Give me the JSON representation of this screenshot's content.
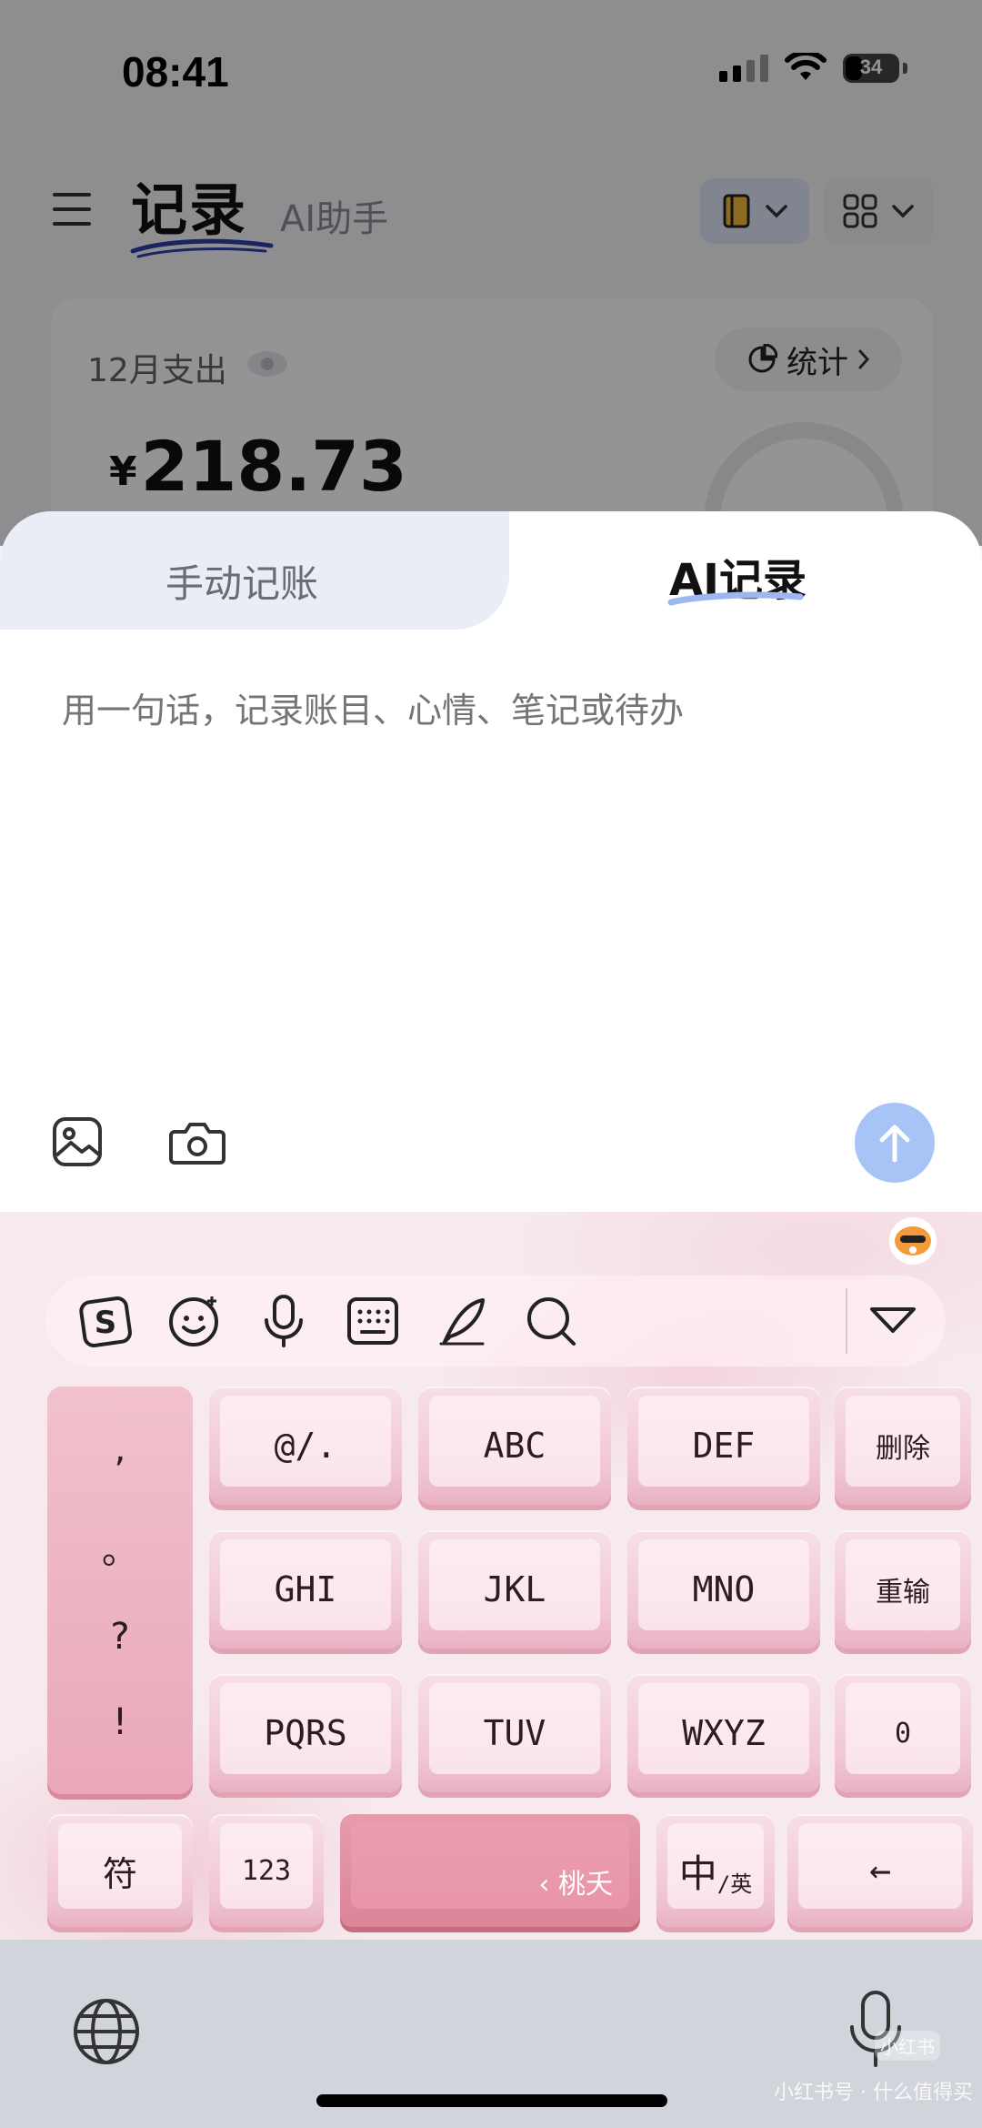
{
  "status": {
    "time": "08:41",
    "battery": "34"
  },
  "header": {
    "brand": "记录",
    "subtitle": "AI助手"
  },
  "summary": {
    "month_label": "12月支出",
    "stats_label": "统计",
    "currency": "¥",
    "amount": "218.73"
  },
  "sheet": {
    "tab_manual": "手动记账",
    "tab_ai": "AI记录",
    "input_placeholder": "用一句话，记录账目、心情、笔记或待办"
  },
  "keyboard": {
    "punctuation": [
      ",",
      "。",
      "?",
      "!"
    ],
    "row1": [
      "@/.",
      "ABC",
      "DEF",
      "删除"
    ],
    "row2": [
      "GHI",
      "JKL",
      "MNO",
      "重输"
    ],
    "row3": [
      "PQRS",
      "TUV",
      "WXYZ",
      "0"
    ],
    "bottom": {
      "symbols": "符",
      "numbers": "123",
      "space": "‹ 桃夭",
      "lang_main": "中",
      "lang_sub": "/英",
      "enter": "←"
    }
  },
  "watermark": {
    "badge": "小红书",
    "text": "小红书号",
    "site": "什么值得买"
  },
  "colors": {
    "accent": "#a8c3f6",
    "keyboard_pink": "#f1c7d3"
  }
}
